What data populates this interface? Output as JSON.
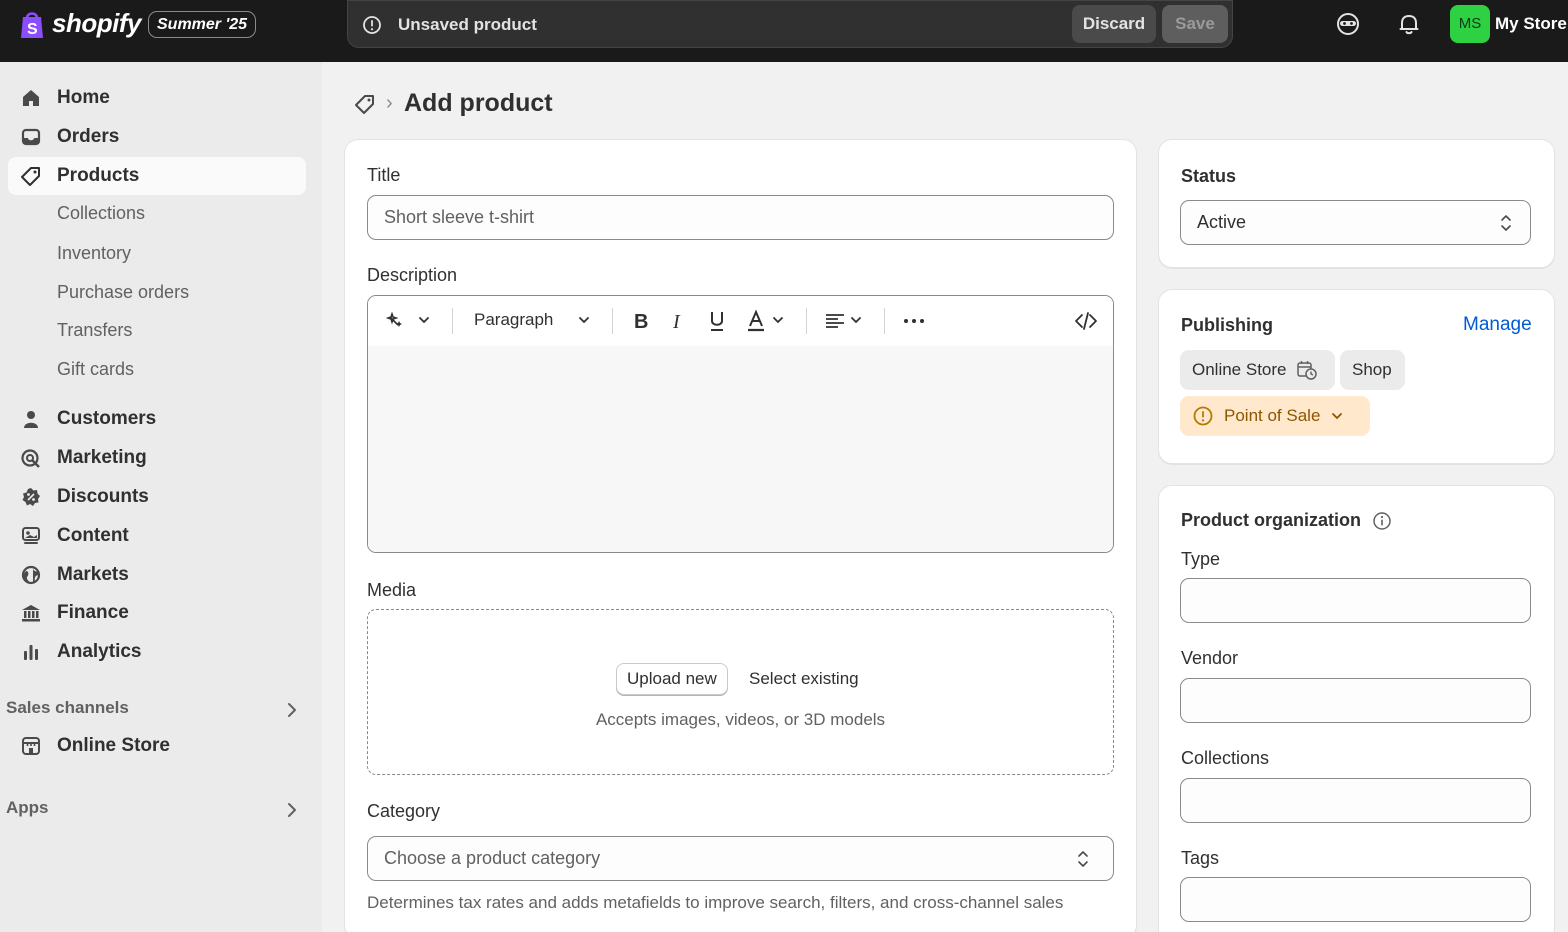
{
  "topbar": {
    "brand": "shopify",
    "edition": "Summer '25",
    "save_bar_message": "Unsaved product",
    "discard_label": "Discard",
    "save_label": "Save",
    "avatar_initials": "MS",
    "store_name": "My Store"
  },
  "sidebar": {
    "items": [
      {
        "label": "Home",
        "icon": "home-icon"
      },
      {
        "label": "Orders",
        "icon": "inbox-icon"
      },
      {
        "label": "Products",
        "icon": "tag-icon",
        "active": true
      },
      {
        "label": "Customers",
        "icon": "person-icon"
      },
      {
        "label": "Marketing",
        "icon": "target-icon"
      },
      {
        "label": "Discounts",
        "icon": "discount-icon"
      },
      {
        "label": "Content",
        "icon": "content-icon"
      },
      {
        "label": "Markets",
        "icon": "globe-icon"
      },
      {
        "label": "Finance",
        "icon": "bank-icon"
      },
      {
        "label": "Analytics",
        "icon": "bar-chart-icon"
      }
    ],
    "product_subitems": [
      "Collections",
      "Inventory",
      "Purchase orders",
      "Transfers",
      "Gift cards"
    ],
    "sales_channels_heading": "Sales channels",
    "online_store_label": "Online Store",
    "apps_heading": "Apps"
  },
  "page": {
    "title": "Add product"
  },
  "product_form": {
    "title_label": "Title",
    "title_value": "Short sleeve t-shirt",
    "description_label": "Description",
    "editor_paragraph": "Paragraph",
    "media_label": "Media",
    "upload_new": "Upload new",
    "select_existing": "Select existing",
    "media_hint": "Accepts images, videos, or 3D models",
    "category_label": "Category",
    "category_placeholder": "Choose a product category",
    "category_help": "Determines tax rates and adds metafields to improve search, filters, and cross-channel sales"
  },
  "status_card": {
    "title": "Status",
    "value": "Active"
  },
  "publishing_card": {
    "title": "Publishing",
    "manage_label": "Manage",
    "channels": [
      "Online Store",
      "Shop"
    ],
    "point_of_sale": "Point of Sale"
  },
  "organization_card": {
    "title": "Product organization",
    "type_label": "Type",
    "vendor_label": "Vendor",
    "collections_label": "Collections",
    "tags_label": "Tags"
  },
  "colors": {
    "topbar": "#1a1a1a",
    "brand_purple": "#8a4dff",
    "avatar_green": "#2ed142",
    "link_blue": "#005bd3",
    "warning_bg": "#ffe8cc"
  }
}
